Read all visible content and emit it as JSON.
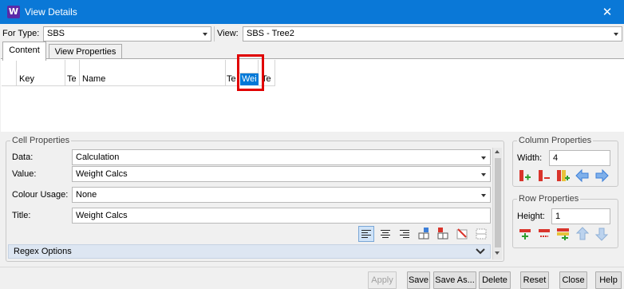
{
  "window": {
    "title": "View Details",
    "app_icon_letter": "W",
    "close_glyph": "✕"
  },
  "top": {
    "for_type_label": "For Type:",
    "for_type_value": "SBS",
    "view_label": "View:",
    "view_value": "SBS - Tree2"
  },
  "tabs": [
    {
      "label": "Content",
      "active": true
    },
    {
      "label": "View Properties",
      "active": false
    }
  ],
  "grid": {
    "columns": [
      {
        "label": "Key"
      },
      {
        "label": "Te"
      },
      {
        "label": "Name"
      },
      {
        "label": "Te"
      },
      {
        "label": "Wei",
        "selected": true
      },
      {
        "label": "Te"
      }
    ]
  },
  "cell_properties": {
    "title": "Cell Properties",
    "data_label": "Data:",
    "data_value": "Calculation",
    "value_label": "Value:",
    "value_value": "Weight Calcs",
    "colour_label": "Colour Usage:",
    "colour_value": "None",
    "title_label": "Title:",
    "title_value": "Weight Calcs",
    "regex_label": "Regex Options",
    "align_icons": [
      "align-left-icon",
      "align-center-icon",
      "align-right-icon",
      "insert-column-left-icon",
      "insert-column-right-icon",
      "delete-column-icon",
      "grid-icon"
    ]
  },
  "column_properties": {
    "title": "Column Properties",
    "width_label": "Width:",
    "width_value": "4",
    "icons": [
      "add-column-icon",
      "remove-column-icon",
      "insert-column-icon",
      "arrow-left-icon",
      "arrow-right-icon"
    ]
  },
  "row_properties": {
    "title": "Row Properties",
    "height_label": "Height:",
    "height_value": "1",
    "icons": [
      "add-row-icon",
      "remove-row-icon",
      "insert-row-icon",
      "arrow-up-icon",
      "arrow-down-icon"
    ]
  },
  "footer": {
    "apply": "Apply",
    "save": "Save",
    "save_as": "Save As...",
    "delete": "Delete",
    "reset": "Reset",
    "close": "Close",
    "help": "Help"
  },
  "colors": {
    "titlebar": "#0a78d7",
    "selection": "#0078d7",
    "highlight_box": "#e00000",
    "icon_red": "#d9342b",
    "icon_blue": "#3c7fd9"
  }
}
